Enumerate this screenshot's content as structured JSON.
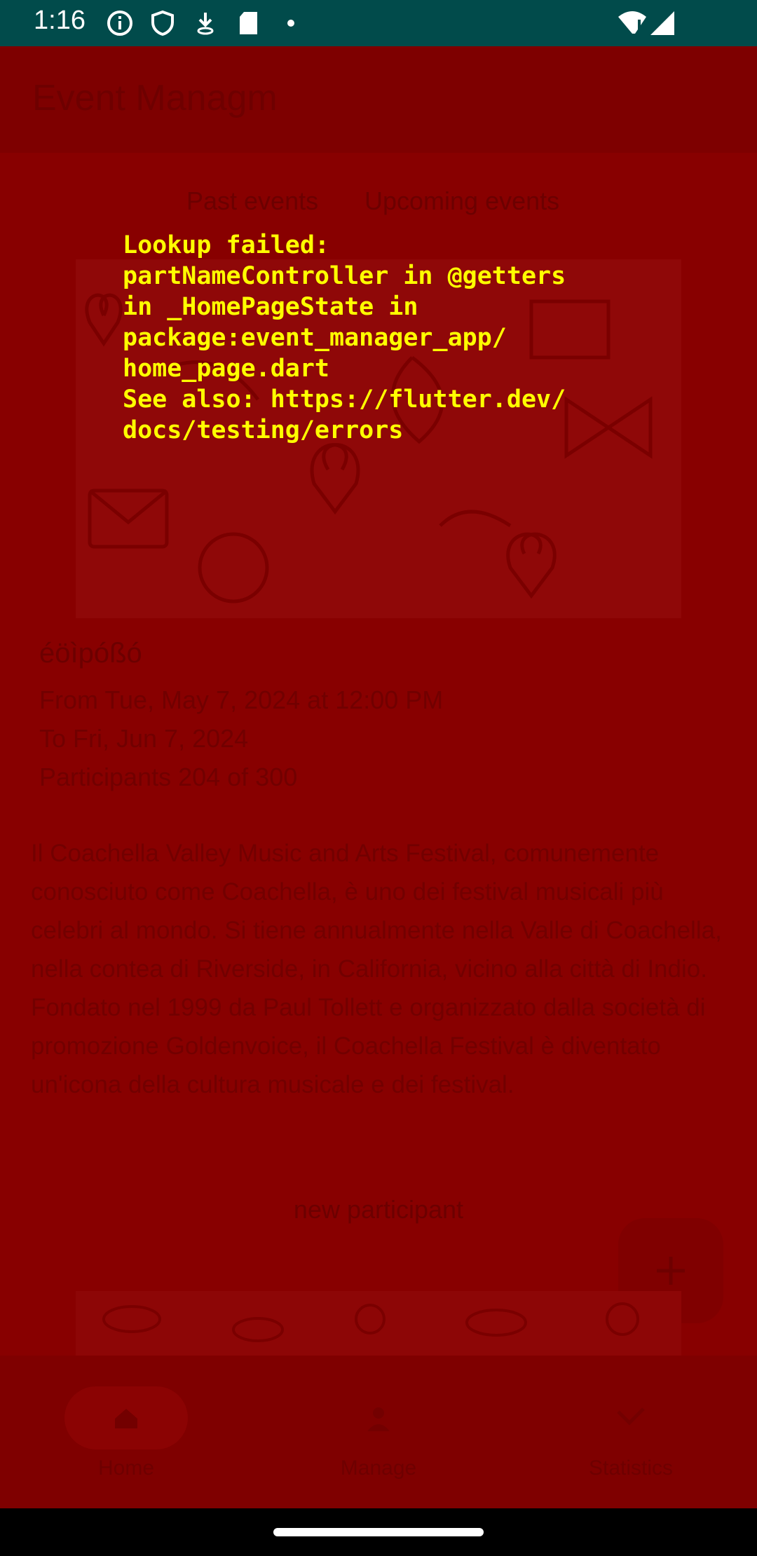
{
  "status_bar": {
    "time": "1:16",
    "icons": [
      "info-icon",
      "shield-icon",
      "download-icon",
      "sd-card-icon",
      "dot-icon",
      "wifi-icon",
      "signal-icon"
    ]
  },
  "app": {
    "title": "Event Managm",
    "tabs": [
      "Past events",
      "Upcoming events"
    ],
    "event": {
      "name": "éöìpóßó",
      "from": "From Tue, May 7, 2024 at 12:00 PM",
      "to": "To Fri, Jun 7, 2024",
      "participants": "Participants 204 of 300",
      "description": "Il Coachella Valley Music and Arts Festival, comunemente conosciuto come Coachella, è uno dei festival musicali più celebri al mondo. Si tiene annualmente nella Valle di Coachella, nella contea di Riverside, in California, vicino alla città di Indio. Fondato nel 1999 da Paul Tollett e organizzato dalla società di promozione Goldenvoice, il Coachella Festival è diventato un'icona della cultura musicale e dei festival."
    },
    "new_participant": "new participant",
    "fab_icon": "plus-icon",
    "bottom_nav": [
      {
        "label": "Home",
        "icon": "home-icon"
      },
      {
        "label": "Manage",
        "icon": "person-icon"
      },
      {
        "label": "Statistics",
        "icon": "chart-icon"
      }
    ]
  },
  "error": {
    "message": "Lookup failed:\npartNameController in @getters\nin _HomePageState in\npackage:event_manager_app/\nhome_page.dart\nSee also: https://flutter.dev/\ndocs/testing/errors"
  },
  "colors": {
    "error_background": "#880000",
    "error_text": "#ffff00",
    "status_bar": "#014b4b"
  }
}
